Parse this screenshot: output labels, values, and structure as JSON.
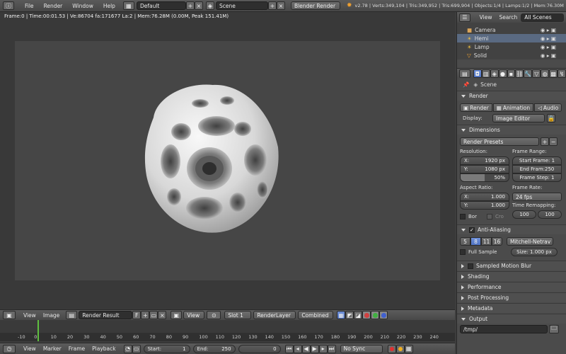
{
  "app": {
    "version_stats": "v2.78 | Verts:349,104 | Tris:349,952 | Tris:699,904 | Objects:1/4 | Lamps:1/2 | Mem:76.30M",
    "menu": [
      "File",
      "Render",
      "Window",
      "Help"
    ],
    "layout": "Default",
    "scene": "Scene",
    "engine": "Blender Render"
  },
  "render_stats": "Frame:0 | Time:00:01.53 | Ve:86704 fa:171677 La:2 | Mem:76.28M (0.00M, Peak 151.41M)",
  "outliner": {
    "tabs": [
      "View",
      "Search",
      "All Scenes"
    ],
    "items": [
      {
        "name": "Camera",
        "icon": "camera-icon"
      },
      {
        "name": "Hemi",
        "icon": "lamp-icon"
      },
      {
        "name": "Lamp",
        "icon": "lamp-icon"
      },
      {
        "name": "Solid",
        "icon": "mesh-icon"
      }
    ]
  },
  "properties": {
    "scene_label": "Scene",
    "render_title": "Render",
    "render_buttons": [
      "Render",
      "Animation",
      "Audio"
    ],
    "display_label": "Display:",
    "display_value": "Image Editor",
    "dimensions_title": "Dimensions",
    "presets": "Render Presets",
    "resolution_label": "Resolution:",
    "res_x_label": "X:",
    "res_x": "1920 px",
    "res_y_label": "Y:",
    "res_y": "1080 px",
    "res_pct": "50%",
    "frame_range_label": "Frame Range:",
    "start_frame": "Start Frame: 1",
    "end_frame": "End Fram:250",
    "frame_step": "Frame Step: 1",
    "aspect_label": "Aspect Ratio:",
    "asp_x_label": "X:",
    "asp_x": "1.000",
    "asp_y_label": "Y:",
    "asp_y": "1.000",
    "frame_rate_label": "Frame Rate:",
    "fps": "24 fps",
    "remap_label": "Time Remapping:",
    "remap_old": "100",
    "remap_new": "100",
    "bor": "Bor",
    "cro": "Cro",
    "aa_title": "Anti-Aliasing",
    "aa_samples": [
      "5",
      "8",
      "11",
      "16"
    ],
    "aa_filter": "Mitchell-Netrav",
    "full_sample": "Full Sample",
    "aa_size": "Size: 1.000 px",
    "collapsed": [
      "Sampled Motion Blur",
      "Shading",
      "Performance",
      "Post Processing",
      "Metadata"
    ],
    "output_title": "Output",
    "output_path": "/tmp/"
  },
  "image_editor": {
    "menu": [
      "View",
      "Image"
    ],
    "image_name": "Render Result",
    "f_label": "F",
    "view_label": "View",
    "slot": "Slot 1",
    "layer": "RenderLayer",
    "pass": "Combined"
  },
  "timeline": {
    "ticks": [
      "-10",
      "0",
      "10",
      "20",
      "30",
      "40",
      "50",
      "60",
      "70",
      "80",
      "90",
      "100",
      "110",
      "120",
      "130",
      "140",
      "150",
      "160",
      "170",
      "180",
      "190",
      "200",
      "210",
      "220",
      "230",
      "240"
    ],
    "menu": [
      "View",
      "Marker",
      "Frame",
      "Playback"
    ],
    "start": "Start:",
    "start_val": "1",
    "end": "End:",
    "end_val": "250",
    "current": "0",
    "sync": "No Sync"
  },
  "colors": {
    "accent_blue": "#5680c2",
    "header": "#4f4f4f",
    "playhead": "#5fbf3f"
  }
}
